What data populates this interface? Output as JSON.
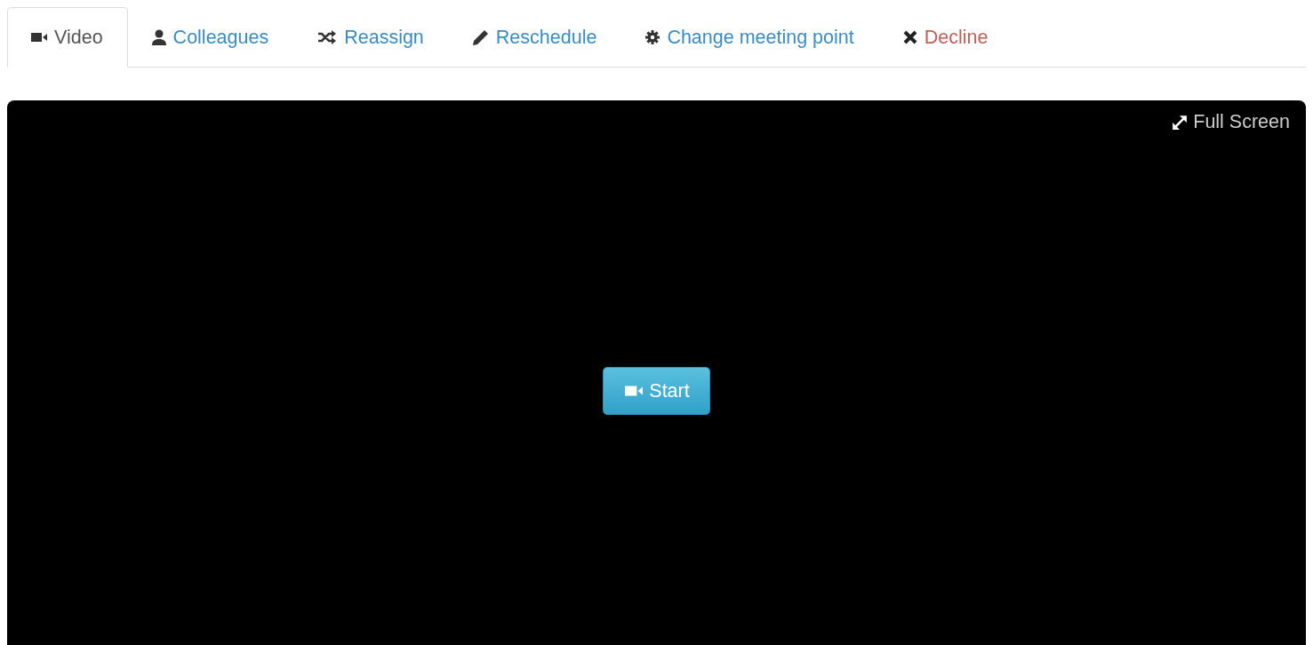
{
  "tabs": [
    {
      "label": "Video",
      "kind": "video",
      "selected": true
    },
    {
      "label": "Colleagues",
      "kind": "person",
      "selected": false
    },
    {
      "label": "Reassign",
      "kind": "shuffle",
      "selected": false
    },
    {
      "label": "Reschedule",
      "kind": "pencil",
      "selected": false
    },
    {
      "label": "Change meeting point",
      "kind": "gear",
      "selected": false
    },
    {
      "label": "Decline",
      "kind": "cross",
      "selected": false,
      "danger": true
    }
  ],
  "video_panel": {
    "full_screen": "Full Screen",
    "start_button": "Start"
  }
}
